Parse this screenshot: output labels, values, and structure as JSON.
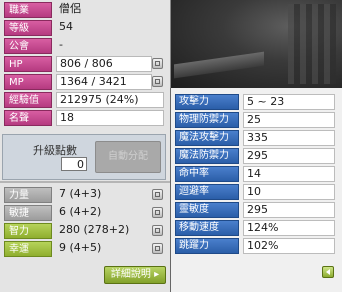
{
  "info": {
    "job": {
      "label": "職業",
      "value": "僧侶"
    },
    "level": {
      "label": "等級",
      "value": "54"
    },
    "guild": {
      "label": "公會",
      "value": "-"
    },
    "hp": {
      "label": "HP",
      "value": "806 / 806"
    },
    "mp": {
      "label": "MP",
      "value": "1364 / 3421"
    },
    "exp": {
      "label": "經驗值",
      "value": "212975 (24%)"
    },
    "fame": {
      "label": "名聲",
      "value": "18"
    }
  },
  "ability_points": {
    "label": "升級點數",
    "value": "0",
    "auto_assign_label": "自動分配"
  },
  "stats": {
    "str": {
      "label": "力量",
      "value": "7 (4+3)"
    },
    "dex": {
      "label": "敏捷",
      "value": "6 (4+2)"
    },
    "int": {
      "label": "智力",
      "value": "280 (278+2)"
    },
    "luk": {
      "label": "幸運",
      "value": "9 (4+5)"
    }
  },
  "detail_button_label": "詳細說明 ▸",
  "detail": {
    "attack": {
      "label": "攻擊力",
      "value": "5 ~ 23"
    },
    "wdef": {
      "label": "物理防禦力",
      "value": "25"
    },
    "matk": {
      "label": "魔法攻擊力",
      "value": "335"
    },
    "mdef": {
      "label": "魔法防禦力",
      "value": "295"
    },
    "acc": {
      "label": "命中率",
      "value": "14"
    },
    "avoid": {
      "label": "迴避率",
      "value": "10"
    },
    "hands": {
      "label": "靈敏度",
      "value": "295"
    },
    "speed": {
      "label": "移動速度",
      "value": "124%"
    },
    "jump": {
      "label": "跳躍力",
      "value": "102%"
    }
  },
  "colors": {
    "info_label": "#c8488f",
    "stat_label_active": "#9dbd3e",
    "detail_label": "#3a6fbc"
  }
}
